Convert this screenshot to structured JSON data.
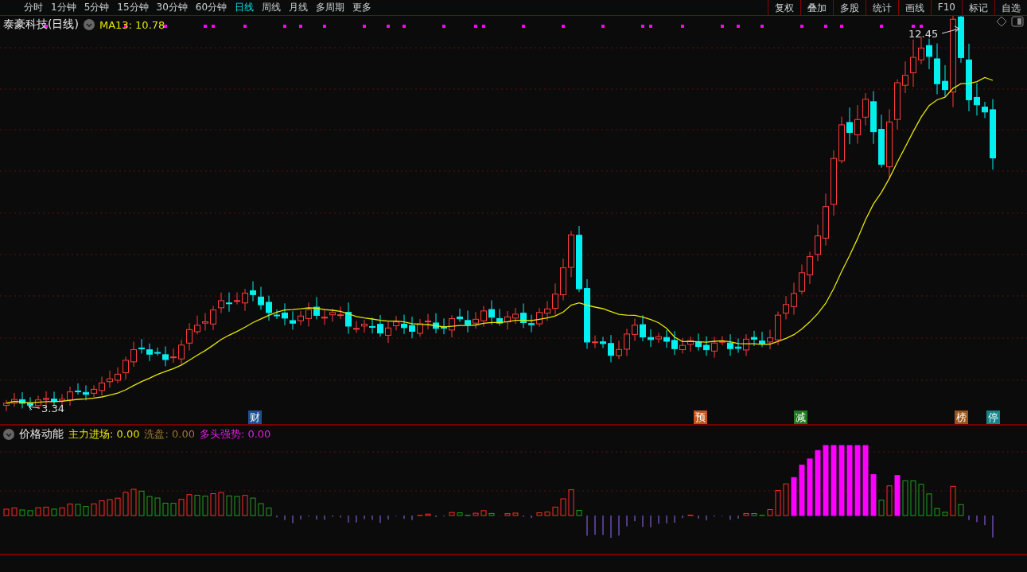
{
  "toolbar": {
    "left_items": [
      {
        "label": "分时",
        "selected": false
      },
      {
        "label": "1分钟",
        "selected": false
      },
      {
        "label": "5分钟",
        "selected": false
      },
      {
        "label": "15分钟",
        "selected": false
      },
      {
        "label": "30分钟",
        "selected": false
      },
      {
        "label": "60分钟",
        "selected": false
      },
      {
        "label": "日线",
        "selected": true
      },
      {
        "label": "周线",
        "selected": false
      },
      {
        "label": "月线",
        "selected": false
      },
      {
        "label": "多周期",
        "selected": false
      },
      {
        "label": "更多",
        "selected": false
      }
    ],
    "right_items": [
      "复权",
      "叠加",
      "多股",
      "统计",
      "画线",
      "F10",
      "标记",
      "自选"
    ]
  },
  "main_chart": {
    "title": "泰豪科技(日线)",
    "indicator": "MA13: 10.78",
    "low_label": "3.34",
    "high_label": "12.45",
    "event_badges": [
      {
        "label": "财",
        "color": "#1e4f8f"
      },
      {
        "label": "预",
        "color": "#c0561c"
      },
      {
        "label": "减",
        "color": "#1d7a1d"
      },
      {
        "label": "榜",
        "color": "#9a5418"
      },
      {
        "label": "停",
        "color": "#13858a"
      }
    ]
  },
  "sub_chart": {
    "title": "价格动能",
    "values": [
      {
        "label": "主力进场: 0.00",
        "color": "#e6e600"
      },
      {
        "label": "洗盘: 0.00",
        "color": "#9c7a2a"
      },
      {
        "label": "多头强势: 0.00",
        "color": "#e020e0"
      }
    ]
  }
}
